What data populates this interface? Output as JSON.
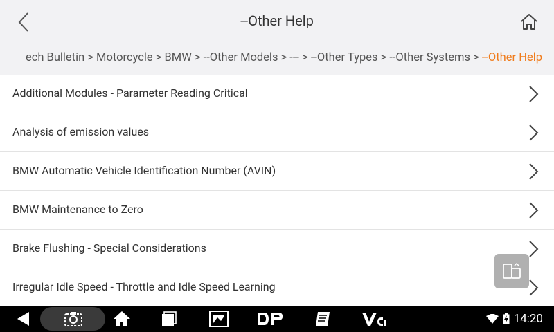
{
  "header": {
    "title": "--Other Help"
  },
  "breadcrumb": {
    "items": [
      "ech Bulletin",
      "Motorcycle",
      "BMW",
      "--Other Models",
      "---",
      "--Other Types",
      "--Other Systems",
      "--Other Help"
    ],
    "separator": ">"
  },
  "list": {
    "items": [
      "Additional Modules - Parameter Reading Critical",
      "Analysis of emission values",
      "BMW Automatic Vehicle Identification Number (AVIN)",
      "BMW Maintenance to Zero",
      "Brake Flushing - Special Considerations",
      "Irregular Idle Speed - Throttle and Idle Speed Learning"
    ]
  },
  "status_bar": {
    "time": "14:20"
  },
  "colors": {
    "accent": "#f07c1c",
    "background": "#f2f2f4",
    "navbar": "#000000"
  },
  "icons": {
    "back": "back-arrow-icon",
    "home": "home-icon",
    "chevron": "chevron-right-icon",
    "float": "window-switch-icon"
  }
}
